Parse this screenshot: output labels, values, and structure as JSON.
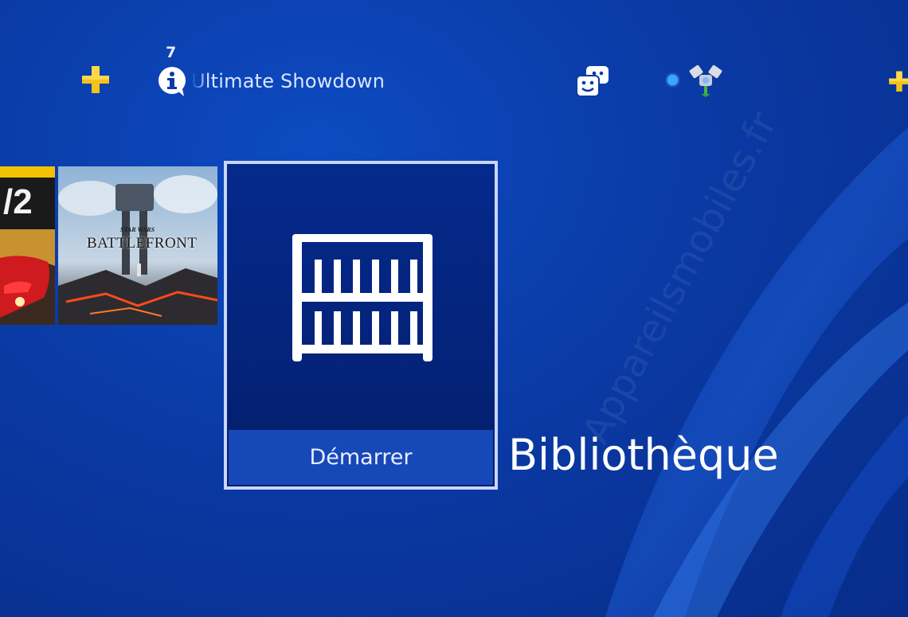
{
  "function_area": {
    "items": [
      {
        "icon": "ps-plus-icon"
      },
      {
        "icon": "notifications-icon",
        "count": "7",
        "ticker_text": "Ultimate Showdown"
      },
      {
        "icon": "friends-icon"
      },
      {
        "icon": "trophies-icon",
        "online_indicator": true
      },
      {
        "icon": "ps-plus-icon"
      }
    ]
  },
  "content_area": {
    "tiles": [
      {
        "name": "racing-game-tile",
        "title_fragment": "/2"
      },
      {
        "name": "star-wars-battlefront-tile",
        "logo_small": "STAR WARS",
        "logo_main": "BATTLEFRONT"
      },
      {
        "name": "library-tile",
        "action_label": "Démarrer",
        "focused": true
      }
    ],
    "focused_title": "Bibliothèque"
  },
  "watermark": "Appareilsmobiles.fr",
  "colors": {
    "background": "#0a3aa5",
    "tile_footer": "#1748b8",
    "focus_border": "#c8d6ff",
    "ps_plus": "#f4c21b",
    "online_dot": "#3aa6ff"
  }
}
